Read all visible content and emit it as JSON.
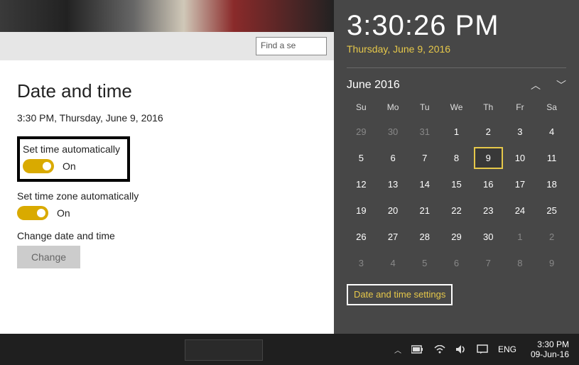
{
  "search": {
    "placeholder": "Find a se"
  },
  "settings": {
    "title": "Date and time",
    "current": "3:30 PM, Thursday, June 9, 2016",
    "auto_time": {
      "label": "Set time automatically",
      "state": "On"
    },
    "auto_tz": {
      "label": "Set time zone automatically",
      "state": "On"
    },
    "change": {
      "label": "Change date and time",
      "button": "Change"
    }
  },
  "flyout": {
    "time": "3:30:26 PM",
    "date": "Thursday, June 9, 2016",
    "month": "June 2016",
    "dow": [
      "Su",
      "Mo",
      "Tu",
      "We",
      "Th",
      "Fr",
      "Sa"
    ],
    "weeks": [
      [
        {
          "n": 29,
          "dim": true
        },
        {
          "n": 30,
          "dim": true
        },
        {
          "n": 31,
          "dim": true
        },
        {
          "n": 1
        },
        {
          "n": 2
        },
        {
          "n": 3
        },
        {
          "n": 4
        }
      ],
      [
        {
          "n": 5
        },
        {
          "n": 6
        },
        {
          "n": 7
        },
        {
          "n": 8
        },
        {
          "n": 9,
          "today": true
        },
        {
          "n": 10
        },
        {
          "n": 11
        }
      ],
      [
        {
          "n": 12
        },
        {
          "n": 13
        },
        {
          "n": 14
        },
        {
          "n": 15
        },
        {
          "n": 16
        },
        {
          "n": 17
        },
        {
          "n": 18
        }
      ],
      [
        {
          "n": 19
        },
        {
          "n": 20
        },
        {
          "n": 21
        },
        {
          "n": 22
        },
        {
          "n": 23
        },
        {
          "n": 24
        },
        {
          "n": 25
        }
      ],
      [
        {
          "n": 26
        },
        {
          "n": 27
        },
        {
          "n": 28
        },
        {
          "n": 29
        },
        {
          "n": 30
        },
        {
          "n": 1,
          "dim": true
        },
        {
          "n": 2,
          "dim": true
        }
      ],
      [
        {
          "n": 3,
          "dim": true
        },
        {
          "n": 4,
          "dim": true
        },
        {
          "n": 5,
          "dim": true
        },
        {
          "n": 6,
          "dim": true
        },
        {
          "n": 7,
          "dim": true
        },
        {
          "n": 8,
          "dim": true
        },
        {
          "n": 9,
          "dim": true
        }
      ]
    ],
    "settings_link": "Date and time settings"
  },
  "taskbar": {
    "lang": "ENG",
    "clock_time": "3:30 PM",
    "clock_date": "09-Jun-16"
  }
}
